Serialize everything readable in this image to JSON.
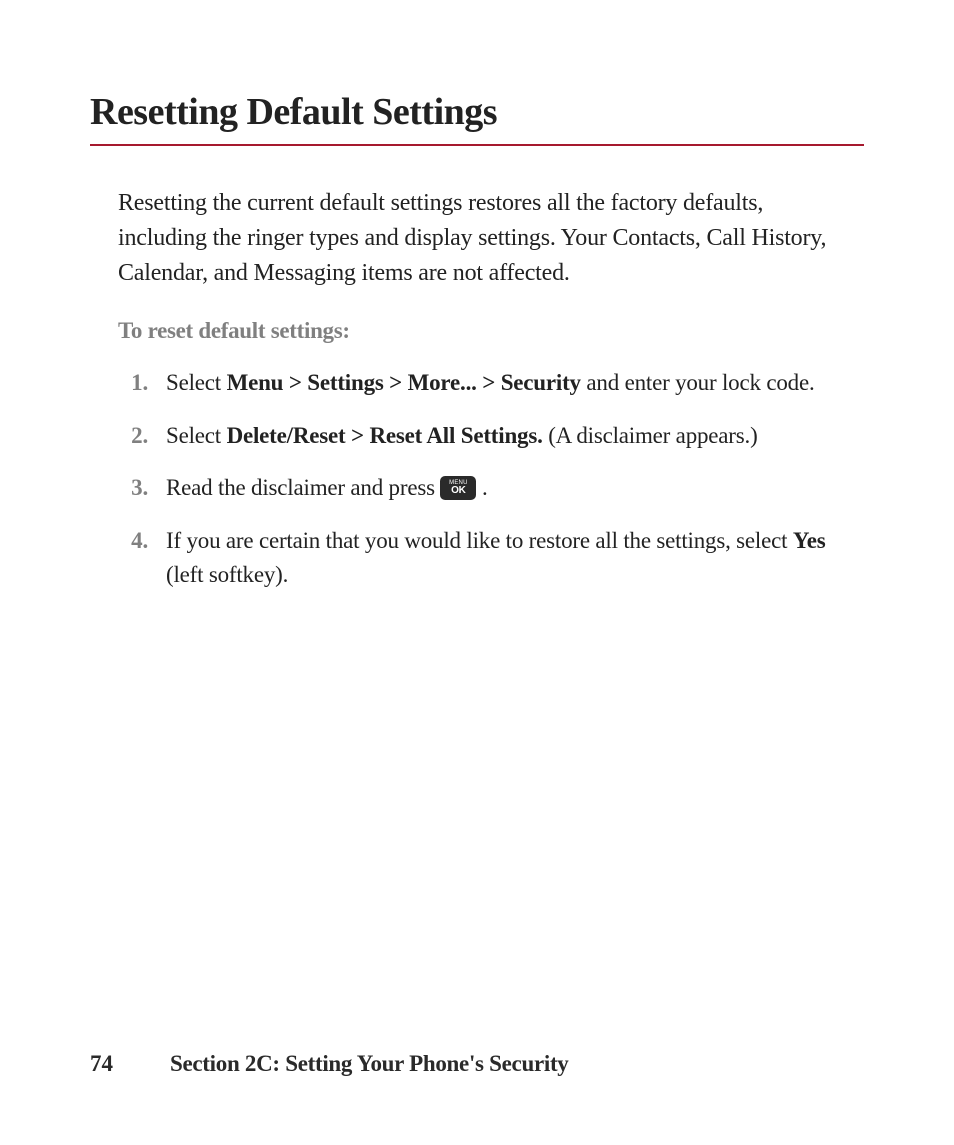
{
  "title": "Resetting Default Settings",
  "intro": "Resetting the current default settings restores all the factory defaults, including the ringer types and display settings. Your Contacts, Call History, Calendar, and Messaging items are not affected.",
  "subheading": "To reset default settings:",
  "steps": [
    {
      "num": "1.",
      "pre": "Select ",
      "bold": "Menu > Settings > More... > Security",
      "post": " and enter your lock code."
    },
    {
      "num": "2.",
      "pre": "Select ",
      "bold": "Delete/Reset > Reset All Settings.",
      "post": "  (A disclaimer appears.)"
    },
    {
      "num": "3.",
      "pre": "Read the disclaimer and press ",
      "has_key": true,
      "key_menu": "MENU",
      "key_ok": "OK",
      "post": " ."
    },
    {
      "num": "4.",
      "pre": "If you are certain that you would like to restore all the settings, select ",
      "bold": "Yes",
      "post": " (left softkey)."
    }
  ],
  "footer": {
    "page": "74",
    "section": "Section 2C: Setting Your Phone's Security"
  }
}
